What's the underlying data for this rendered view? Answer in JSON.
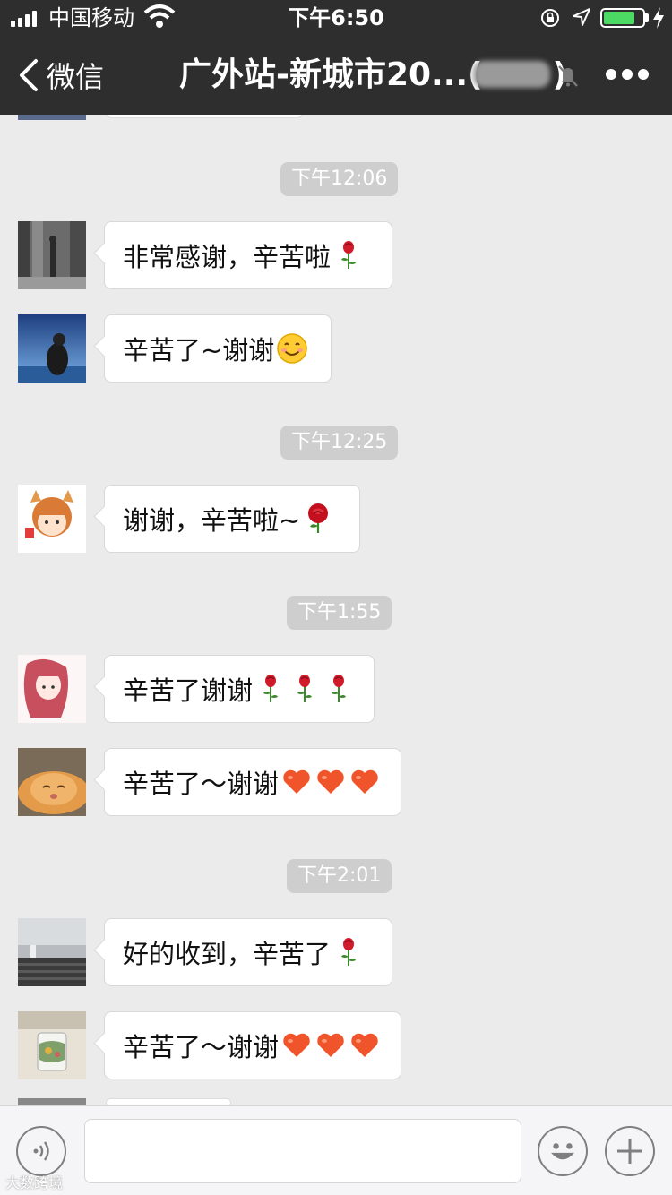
{
  "status_bar": {
    "carrier": "中国移动",
    "time": "下午6:50",
    "battery_color": "#4cd964"
  },
  "nav": {
    "back_label": "微信",
    "title": "广外站-新城市20...(",
    "title_close": ")"
  },
  "colors": {
    "nav_bg": "#2e2e2e",
    "chat_bg": "#ebebeb",
    "bubble_bg": "#ffffff",
    "timestamp_bg": "#cecece"
  },
  "timestamps": [
    "下午12:06",
    "下午12:25",
    "下午1:55",
    "下午2:01"
  ],
  "messages": [
    {
      "text": "非常感谢，辛苦啦",
      "emoji": [
        "rose-icon"
      ]
    },
    {
      "text": "辛苦了~谢谢",
      "emoji": [
        "smile-icon"
      ]
    },
    {
      "text": "谢谢，辛苦啦~",
      "emoji": [
        "red-rose-icon"
      ]
    },
    {
      "text": "辛苦了谢谢",
      "emoji": [
        "rose-icon",
        "rose-icon",
        "rose-icon"
      ]
    },
    {
      "text": "辛苦了～谢谢",
      "emoji": [
        "heart-icon",
        "heart-icon",
        "heart-icon"
      ]
    },
    {
      "text": "好的收到，辛苦了",
      "emoji": [
        "rose-icon"
      ]
    },
    {
      "text": "辛苦了～谢谢",
      "emoji": [
        "heart-icon",
        "heart-icon",
        "heart-icon"
      ]
    }
  ],
  "watermark": "大数跨境",
  "input": {
    "placeholder": ""
  }
}
